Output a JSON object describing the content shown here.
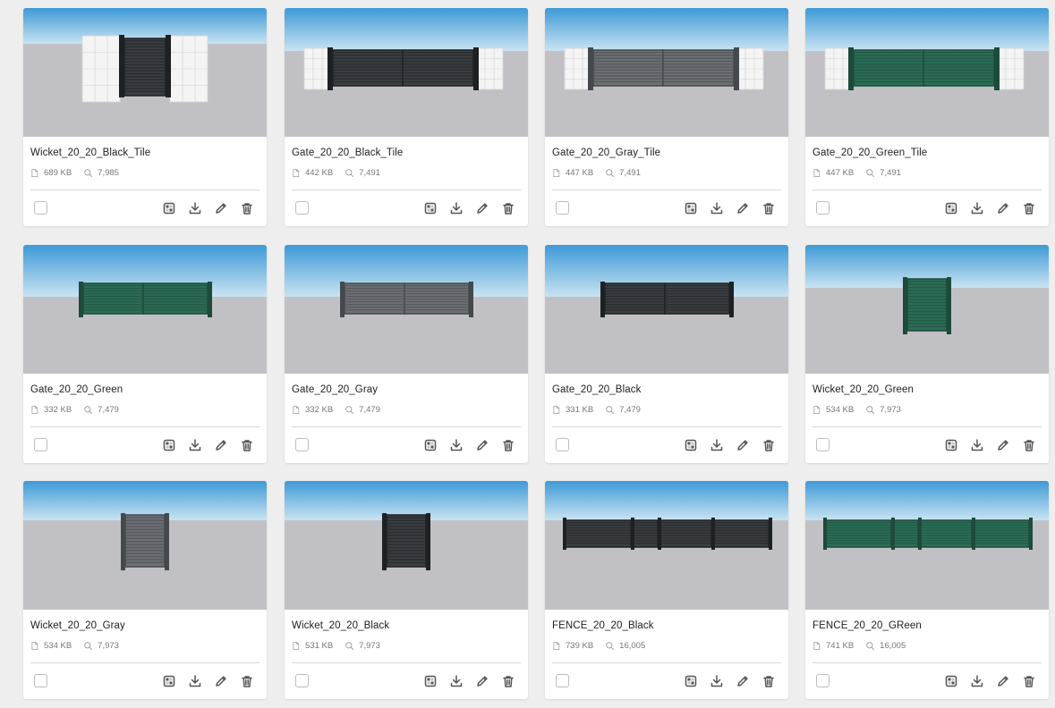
{
  "colors": {
    "background": "#eeeeee",
    "card": "#ffffff",
    "sky_top": "#3d9ad6",
    "sky_bottom": "#c9e3f2",
    "ground": "#c1c1c5",
    "frame_black": "#1e2124",
    "frame_gray": "#45494d",
    "frame_green": "#1d4a3b",
    "slat_black": "#3b3e42",
    "slat_gray": "#6d7075",
    "slat_green": "#2c6e57",
    "icon": "#555555",
    "meta_icon": "#9a9a9a"
  },
  "icons": {
    "file": "file-icon",
    "views": "views-icon",
    "ar": "ar-icon",
    "download": "download-icon",
    "edit": "edit-icon",
    "delete": "delete-icon"
  },
  "cards": [
    {
      "title": "Wicket_20_20_Black_Tile",
      "size": "689 KB",
      "views": "7,985",
      "scene": "wicket",
      "color": "black",
      "tile": true
    },
    {
      "title": "Gate_20_20_Black_Tile",
      "size": "442 KB",
      "views": "7,491",
      "scene": "gate",
      "color": "black",
      "tile": true
    },
    {
      "title": "Gate_20_20_Gray_Tile",
      "size": "447 KB",
      "views": "7,491",
      "scene": "gate",
      "color": "gray",
      "tile": true
    },
    {
      "title": "Gate_20_20_Green_Tile",
      "size": "447 KB",
      "views": "7,491",
      "scene": "gate",
      "color": "green",
      "tile": true
    },
    {
      "title": "Gate_20_20_Green",
      "size": "332 KB",
      "views": "7,479",
      "scene": "gate",
      "color": "green",
      "tile": false
    },
    {
      "title": "Gate_20_20_Gray",
      "size": "332 KB",
      "views": "7,479",
      "scene": "gate",
      "color": "gray",
      "tile": false
    },
    {
      "title": "Gate_20_20_Black",
      "size": "331 KB",
      "views": "7,479",
      "scene": "gate",
      "color": "black",
      "tile": false
    },
    {
      "title": "Wicket_20_20_Green",
      "size": "534 KB",
      "views": "7,973",
      "scene": "wicket",
      "color": "green",
      "tile": false
    },
    {
      "title": "Wicket_20_20_Gray",
      "size": "534 KB",
      "views": "7,973",
      "scene": "wicket",
      "color": "gray",
      "tile": false
    },
    {
      "title": "Wicket_20_20_Black",
      "size": "531 KB",
      "views": "7,973",
      "scene": "wicket",
      "color": "black",
      "tile": false
    },
    {
      "title": "FENCE_20_20_Black",
      "size": "739 KB",
      "views": "16,005",
      "scene": "fence",
      "color": "black",
      "tile": false
    },
    {
      "title": "FENCE_20_20_GReen",
      "size": "741 KB",
      "views": "16,005",
      "scene": "fence",
      "color": "green",
      "tile": false
    }
  ]
}
